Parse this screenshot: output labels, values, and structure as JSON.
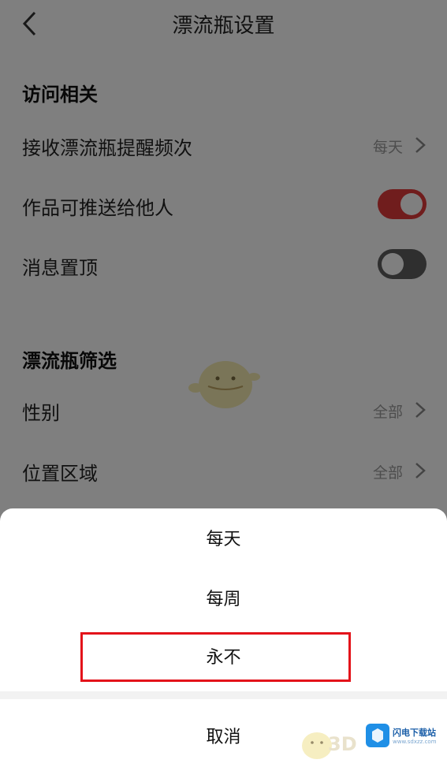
{
  "nav": {
    "title": "漂流瓶设置"
  },
  "access_section": {
    "title": "访问相关",
    "rows": [
      {
        "label": "接收漂流瓶提醒频次",
        "value": "每天"
      },
      {
        "label": "作品可推送给他人",
        "toggle": "on"
      },
      {
        "label": "消息置顶",
        "toggle": "off"
      }
    ]
  },
  "filter_section": {
    "title": "漂流瓶筛选",
    "rows": [
      {
        "label": "性别",
        "value": "全部"
      },
      {
        "label": "位置区域",
        "value": "全部"
      }
    ]
  },
  "sheet": {
    "options": [
      "每天",
      "每周",
      "永不"
    ],
    "highlighted_option": "永不",
    "cancel": "取消"
  },
  "watermark": {
    "name": "闪电下载站",
    "url": "www.sdxzz.com",
    "prefix": "3D"
  },
  "colors": {
    "accent": "#e03a3a",
    "highlight_border": "#e3131a",
    "overlay": "rgba(0,0,0,0.5)"
  }
}
